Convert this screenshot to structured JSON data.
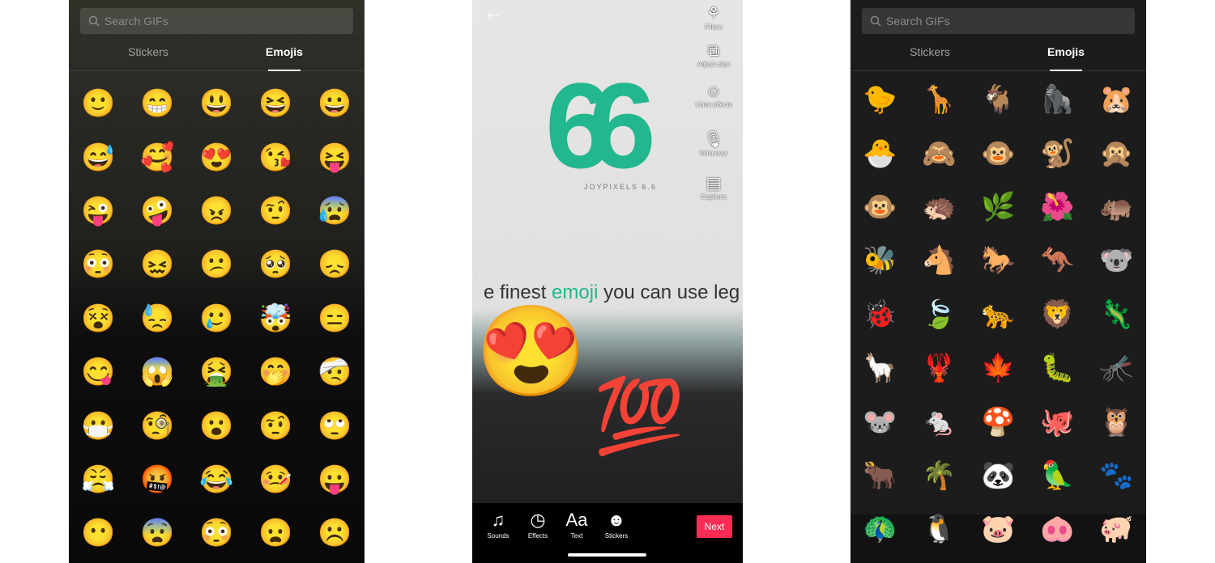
{
  "left": {
    "search_placeholder": "Search GIFs",
    "tabs": [
      "Stickers",
      "Emojis"
    ],
    "active_tab": "Emojis",
    "emojis": [
      "🙂",
      "😁",
      "😃",
      "😆",
      "😀",
      "😅",
      "🥰",
      "😍",
      "😘",
      "😝",
      "😜",
      "🤪",
      "😠",
      "🤨",
      "😰",
      "😳",
      "😖",
      "😕",
      "🥺",
      "😞",
      "😵",
      "😓",
      "🥲",
      "🤯",
      "😑",
      "😋",
      "😱",
      "🤮",
      "🤭",
      "🤕",
      "😷",
      "🧐",
      "😮",
      "🤨",
      "🙄",
      "😤",
      "🤬",
      "😂",
      "🤒",
      "😛",
      "😶",
      "😨",
      "😳",
      "😦",
      "☹️"
    ]
  },
  "middle": {
    "logo_text": "66",
    "logo_caption": "JOYPIXELS 6.6",
    "screen_text_before": "e finest ",
    "screen_text_highlight": "emoji",
    "screen_text_after": " you can use leg",
    "stickers": [
      "😍",
      "💯"
    ],
    "side_tools": [
      {
        "label": "Filters",
        "icon": "filters-icon",
        "glyph": "⚘"
      },
      {
        "label": "Adjust clips",
        "icon": "adjust-clips-icon",
        "glyph": "⧉"
      },
      {
        "label": "Voice effects",
        "icon": "voice-effects-icon",
        "glyph": "☺"
      },
      {
        "label": "Voiceover",
        "icon": "microphone-icon",
        "glyph": "🎙"
      },
      {
        "label": "Captions",
        "icon": "captions-icon",
        "glyph": "▤"
      }
    ],
    "bottom_tools": [
      {
        "label": "Sounds",
        "icon": "music-note-icon",
        "glyph": "♫"
      },
      {
        "label": "Effects",
        "icon": "effects-timer-icon",
        "glyph": "◷"
      },
      {
        "label": "Text",
        "icon": "text-icon",
        "glyph": "Aa"
      },
      {
        "label": "Stickers",
        "icon": "sticker-icon",
        "glyph": "☻"
      }
    ],
    "next_label": "Next",
    "accent": "#fe2c55"
  },
  "right": {
    "search_placeholder": "Search GIFs",
    "tabs": [
      "Stickers",
      "Emojis"
    ],
    "active_tab": "Emojis",
    "emojis": [
      "🐤",
      "🦒",
      "🐐",
      "🦍",
      "🐹",
      "🐣",
      "🙈",
      "🐵",
      "🐒",
      "🙊",
      "🐵",
      "🦔",
      "🌿",
      "🌺",
      "🦛",
      "🐝",
      "🐴",
      "🐎",
      "🦘",
      "🐨",
      "🐞",
      "🍃",
      "🐆",
      "🦁",
      "🦎",
      "🦙",
      "🦞",
      "🍁",
      "🐛",
      "🦟",
      "🐭",
      "🐁",
      "🍄",
      "🐙",
      "🦉",
      "🐂",
      "🌴",
      "🐼",
      "🦜",
      "🐾",
      "🦚",
      "🐧",
      "🐷",
      "🐽",
      "🐖"
    ]
  }
}
